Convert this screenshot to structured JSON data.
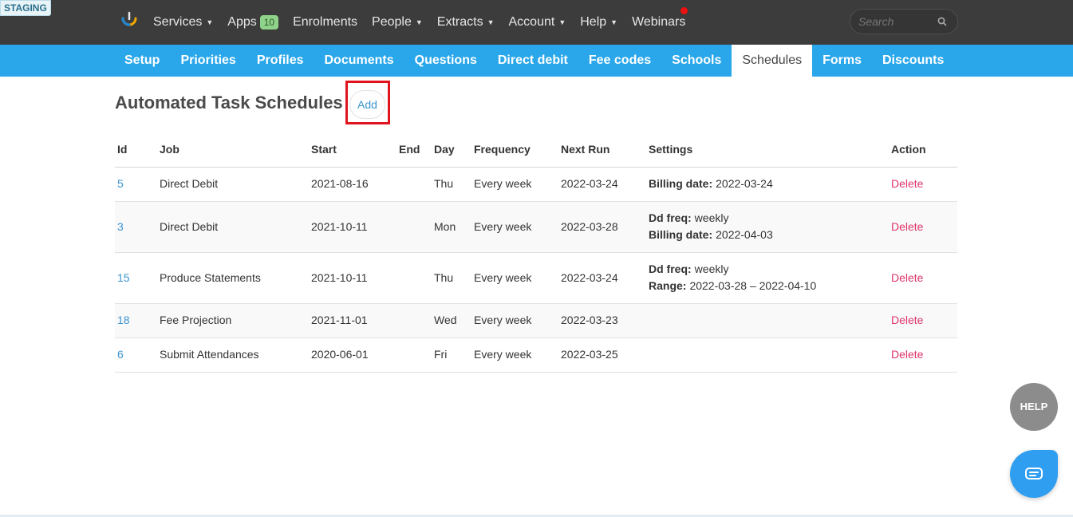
{
  "staging_label": "STAGING",
  "top_nav": [
    {
      "label": "Services",
      "has_caret": true
    },
    {
      "label": "Apps",
      "badge": "10"
    },
    {
      "label": "Enrolments"
    },
    {
      "label": "People",
      "has_caret": true
    },
    {
      "label": "Extracts",
      "has_caret": true
    },
    {
      "label": "Account",
      "has_caret": true
    },
    {
      "label": "Help",
      "has_caret": true
    },
    {
      "label": "Webinars"
    }
  ],
  "search": {
    "placeholder": "Search"
  },
  "sub_nav": {
    "tabs": [
      "Setup",
      "Priorities",
      "Profiles",
      "Documents",
      "Questions",
      "Direct debit",
      "Fee codes",
      "Schools",
      "Schedules",
      "Forms",
      "Discounts"
    ],
    "active": "Schedules"
  },
  "page": {
    "title": "Automated Task Schedules",
    "add_label": "Add"
  },
  "table": {
    "headers": [
      "Id",
      "Job",
      "Start",
      "End",
      "Day",
      "Frequency",
      "Next Run",
      "Settings",
      "Action"
    ],
    "rows": [
      {
        "id": "5",
        "job": "Direct Debit",
        "start": "2021-08-16",
        "end": "",
        "day": "Thu",
        "frequency": "Every week",
        "next_run": "2022-03-24",
        "settings": [
          {
            "key": "Billing date:",
            "value": "2022-03-24"
          }
        ],
        "action": "Delete"
      },
      {
        "id": "3",
        "job": "Direct Debit",
        "start": "2021-10-11",
        "end": "",
        "day": "Mon",
        "frequency": "Every week",
        "next_run": "2022-03-28",
        "settings": [
          {
            "key": "Dd freq:",
            "value": "weekly"
          },
          {
            "key": "Billing date:",
            "value": "2022-04-03"
          }
        ],
        "action": "Delete"
      },
      {
        "id": "15",
        "job": "Produce Statements",
        "start": "2021-10-11",
        "end": "",
        "day": "Thu",
        "frequency": "Every week",
        "next_run": "2022-03-24",
        "settings": [
          {
            "key": "Dd freq:",
            "value": "weekly"
          },
          {
            "key": "Range:",
            "value": "2022-03-28 – 2022-04-10"
          }
        ],
        "action": "Delete"
      },
      {
        "id": "18",
        "job": "Fee Projection",
        "start": "2021-11-01",
        "end": "",
        "day": "Wed",
        "frequency": "Every week",
        "next_run": "2022-03-23",
        "settings": [],
        "action": "Delete"
      },
      {
        "id": "6",
        "job": "Submit Attendances",
        "start": "2020-06-01",
        "end": "",
        "day": "Fri",
        "frequency": "Every week",
        "next_run": "2022-03-25",
        "settings": [],
        "action": "Delete"
      }
    ]
  },
  "help_button_label": "HELP",
  "colors": {
    "topbar": "#3c3c3c",
    "subnav": "#29a7ea",
    "link": "#3a94cf",
    "delete": "#e0356a",
    "highlight": "#e0141e"
  }
}
